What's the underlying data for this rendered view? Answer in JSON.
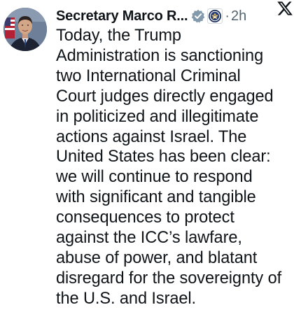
{
  "post": {
    "author_name": "Secretary Marco R...",
    "separator": "·",
    "timestamp": "2h",
    "text": "Today, the Trump\nAdministration is sanctioning\ntwo International Criminal\nCourt judges directly engaged\nin politicized and illegitimate\nactions against Israel. The\nUnited States has been clear:\nwe will continue to respond\nwith significant and tangible\nconsequences to protect\nagainst the ICC’s lawfare,\nabuse of power, and blatant\ndisregard for the sovereignty of\nthe U.S. and Israel."
  },
  "icons": {
    "verified": "verified-badge-icon",
    "affiliation": "state-department-seal-icon",
    "platform": "x-logo-icon"
  },
  "colors": {
    "text": "#0f1419",
    "secondary": "#536471",
    "verified_badge": "#829aab",
    "background": "#ffffff"
  }
}
